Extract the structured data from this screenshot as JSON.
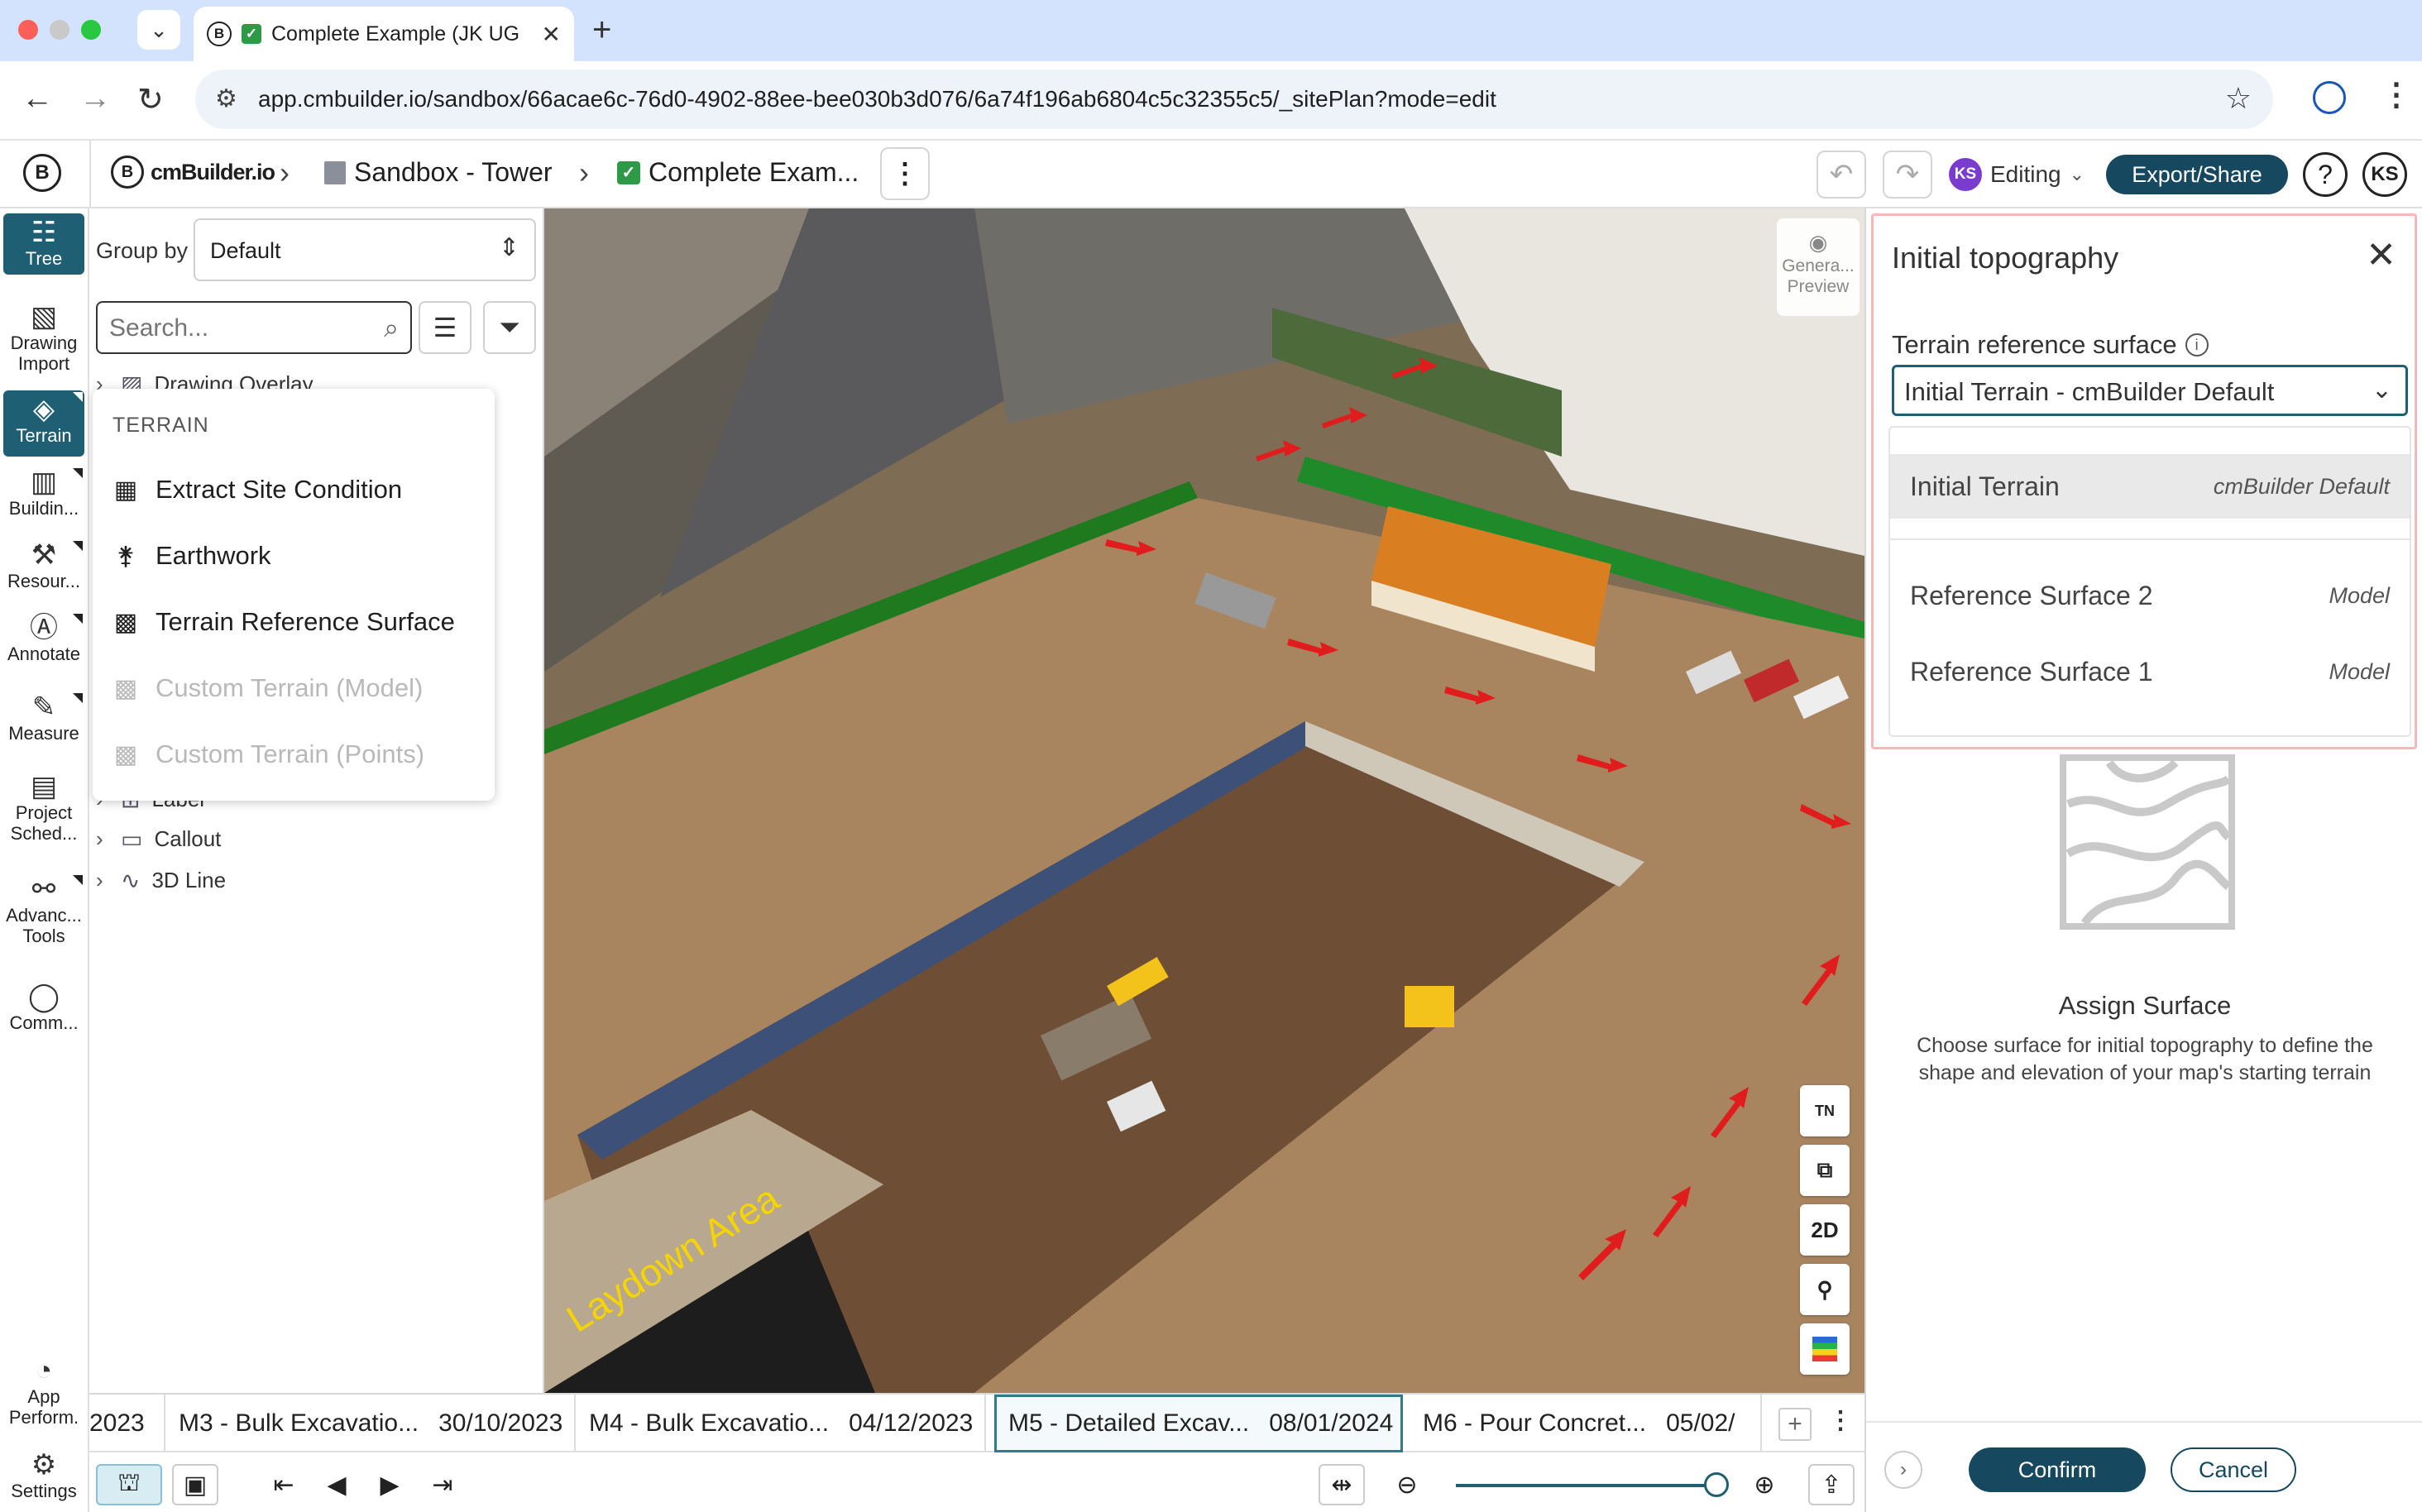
{
  "browser": {
    "tab_title": "Complete Example (JK UG",
    "url": "app.cmbuilder.io/sandbox/66acae6c-76d0-4902-88ee-bee030b3d076/6a74f196ab6804c5c32355c5/_sitePlan?mode=edit"
  },
  "header": {
    "brand": "cmBuilder.io",
    "breadcrumb": [
      "Sandbox - Tower",
      "Complete Exam..."
    ],
    "editing_label": "Editing",
    "editing_initials": "KS",
    "export_label": "Export/Share",
    "help": "?",
    "user_initials": "KS"
  },
  "rail": {
    "items": [
      {
        "label": "Tree",
        "icon": "tree-icon"
      },
      {
        "label": "Drawing Import",
        "icon": "image-icon"
      },
      {
        "label": "Terrain",
        "icon": "terrain-icon"
      },
      {
        "label": "Buildin...",
        "icon": "building-icon"
      },
      {
        "label": "Resour...",
        "icon": "resources-icon"
      },
      {
        "label": "Annotate",
        "icon": "annotate-icon"
      },
      {
        "label": "Measure",
        "icon": "measure-icon"
      },
      {
        "label": "Project Sched...",
        "icon": "schedule-icon"
      },
      {
        "label": "Advanc... Tools",
        "icon": "advanced-tools-icon"
      },
      {
        "label": "Comm...",
        "icon": "comment-icon"
      }
    ],
    "bottom": [
      {
        "label": "App Perform.",
        "icon": "performance-icon"
      },
      {
        "label": "Settings",
        "icon": "gear-icon"
      }
    ]
  },
  "tree_panel": {
    "group_by_label": "Group by",
    "group_by_value": "Default",
    "search_placeholder": "Search...",
    "rows": [
      {
        "label": "Drawing Overlay",
        "icon": "image-icon"
      },
      {
        "label": "Label",
        "icon": "label-icon"
      },
      {
        "label": "Callout",
        "icon": "callout-icon"
      },
      {
        "label": "3D Line",
        "icon": "line-icon"
      }
    ]
  },
  "terrain_menu": {
    "header": "TERRAIN",
    "items": [
      {
        "label": "Extract Site Condition",
        "enabled": true,
        "icon": "extract-icon"
      },
      {
        "label": "Earthwork",
        "enabled": true,
        "icon": "shovel-icon"
      },
      {
        "label": "Terrain Reference Surface",
        "enabled": true,
        "icon": "surface-icon"
      },
      {
        "label": "Custom Terrain (Model)",
        "enabled": false,
        "icon": "surface-icon"
      },
      {
        "label": "Custom Terrain (Points)",
        "enabled": false,
        "icon": "surface-icon"
      }
    ]
  },
  "viewport": {
    "generate_preview": "Genera... Preview",
    "laydown_label": "Laydown Area",
    "tools": [
      "TN",
      "layers",
      "2D",
      "pin",
      "colors"
    ]
  },
  "right_panel": {
    "title": "Initial topography",
    "field_label": "Terrain reference surface",
    "selected_value": "Initial Terrain - cmBuilder Default",
    "options": [
      {
        "name": "Initial Terrain",
        "tag": "cmBuilder Default",
        "selected": true
      },
      {
        "name": "Reference Surface 2",
        "tag": "Model",
        "selected": false
      },
      {
        "name": "Reference Surface 1",
        "tag": "Model",
        "selected": false
      }
    ],
    "assign_title": "Assign Surface",
    "assign_desc": "Choose surface for initial topography to define the shape and elevation of your map's starting terrain",
    "confirm_label": "Confirm",
    "cancel_label": "Cancel"
  },
  "timeline": {
    "leading_date": "2023",
    "milestones": [
      {
        "name": "M3 - Bulk Excavatio...",
        "date": "30/10/2023",
        "active": false
      },
      {
        "name": "M4 - Bulk Excavatio...",
        "date": "04/12/2023",
        "active": false
      },
      {
        "name": "M5 - Detailed Excav...",
        "date": "08/01/2024",
        "active": true
      },
      {
        "name": "M6 - Pour Concret...",
        "date": "05/02/",
        "active": false
      }
    ]
  }
}
